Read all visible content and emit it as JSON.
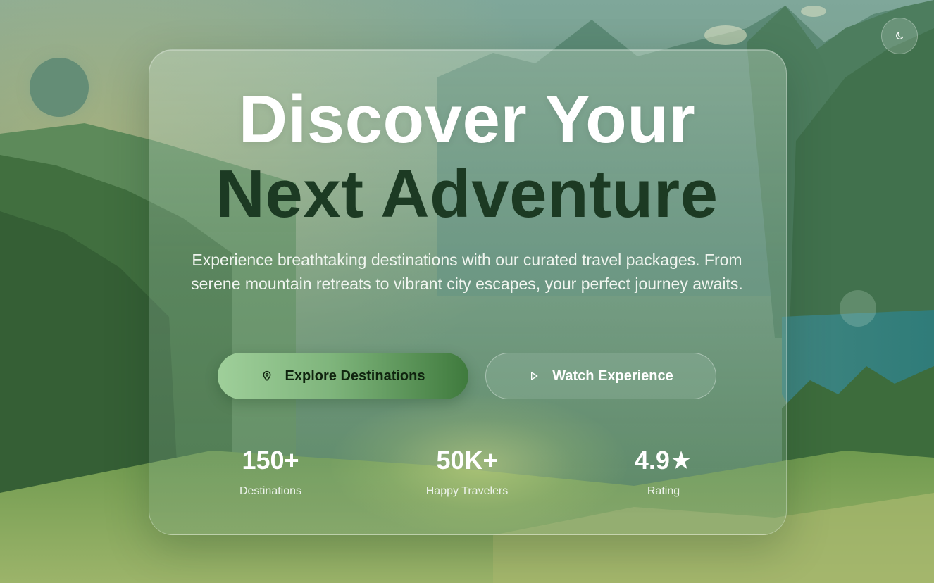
{
  "hero": {
    "title_line1": "Discover Your",
    "title_line2": "Next Adventure",
    "subtitle": "Experience breathtaking destinations with our curated travel packages. From serene mountain retreats to vibrant city escapes, your perfect journey awaits."
  },
  "buttons": {
    "explore_label": "Explore Destinations",
    "explore_icon": "map-pin-icon",
    "watch_label": "Watch Experience",
    "watch_icon": "play-icon"
  },
  "stats": [
    {
      "value": "150+",
      "label": "Destinations"
    },
    {
      "value": "50K+",
      "label": "Happy Travelers"
    },
    {
      "value": "4.9★",
      "label": "Rating"
    }
  ],
  "theme_toggle": {
    "icon": "moon-icon"
  },
  "colors": {
    "title_primary": "#ffffff",
    "title_accent": "#1c3a23",
    "button_gradient_start": "#9fcf9a",
    "button_gradient_end": "#3f7a3d"
  }
}
